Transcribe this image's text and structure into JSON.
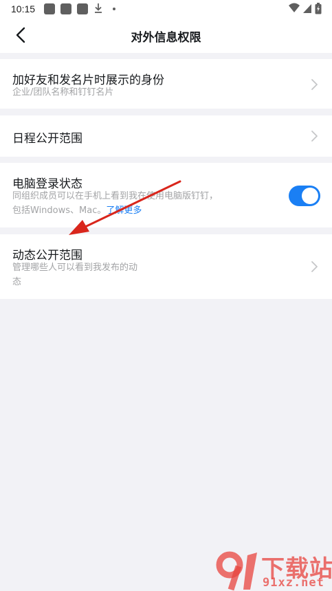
{
  "status_bar": {
    "time": "10:15",
    "icons": [
      "notification-icon",
      "notification-icon",
      "notification-icon",
      "download-icon",
      "dot-icon",
      "wifi-icon",
      "signal-icon",
      "battery-icon"
    ]
  },
  "nav": {
    "title": "对外信息权限",
    "back_icon": "chevron-left-icon"
  },
  "settings": [
    {
      "title": "加好友和发名片时展示的身份",
      "subtitle": "企业/团队名称和钉钉名片",
      "control": "chevron-right-icon"
    },
    {
      "title": "日程公开范围",
      "control": "chevron-right-icon"
    },
    {
      "title": "电脑登录状态",
      "subtitle_line1": "同组织成员可以在手机上看到我在使用电脑版钉钉，",
      "subtitle_line2_prefix": "包括Windows、Mac。",
      "link": "了解更多",
      "control": "toggle",
      "toggle_on": true
    },
    {
      "title": "动态公开范围",
      "subtitle_line1": "管理哪些人可以看到我发布的动",
      "subtitle_line2": "态",
      "control": "chevron-right-icon"
    }
  ],
  "colors": {
    "accent": "#1a7ff4",
    "background": "#f2f2f6",
    "card": "#ffffff",
    "annotation_arrow": "#d9261c",
    "watermark": "#e8443e"
  },
  "watermark": {
    "cn": "下载站",
    "en": "91xz.net"
  }
}
